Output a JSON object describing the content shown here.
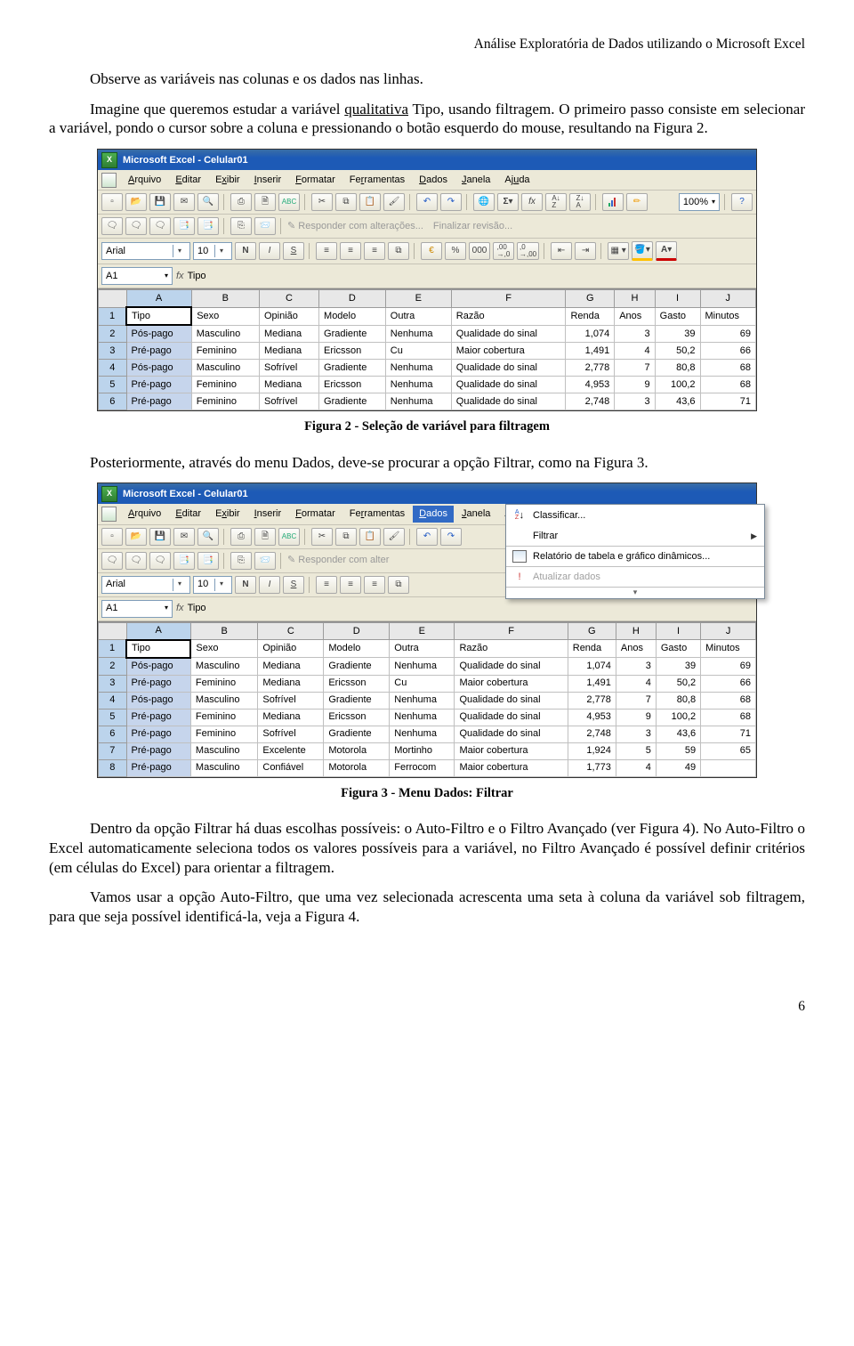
{
  "header": "Análise Exploratória de Dados utilizando o Microsoft Excel",
  "para1_a": "Observe as variáveis nas colunas e os dados nas linhas.",
  "para2_a": "Imagine que queremos estudar a variável ",
  "para2_b": "qualitativa",
  "para2_c": " Tipo, usando filtragem. O primeiro passo consiste em selecionar a variável, pondo o cursor sobre a coluna e pressionando o botão esquerdo do mouse, resultando na Figura 2.",
  "caption1": "Figura 2 - Seleção de variável para filtragem",
  "para3": "Posteriormente, através do menu Dados, deve-se procurar a opção Filtrar, como na Figura 3.",
  "caption2": "Figura 3 - Menu Dados: Filtrar",
  "para4": "Dentro da opção Filtrar há duas escolhas possíveis: o Auto-Filtro e o Filtro Avançado (ver Figura 4). No Auto-Filtro o Excel automaticamente seleciona todos os valores possíveis para a variável, no Filtro Avançado é possível definir critérios (em células do Excel) para orientar a filtragem.",
  "para5": "Vamos usar a opção Auto-Filtro, que uma vez selecionada acrescenta uma seta à coluna da variável sob filtragem, para que seja possível identificá-la, veja a Figura 4.",
  "page": "6",
  "excel": {
    "title": "Microsoft Excel - Celular01",
    "menus": {
      "arquivo": "Arquivo",
      "editar": "Editar",
      "exibir": "Exibir",
      "inserir": "Inserir",
      "formatar": "Formatar",
      "ferramentas": "Ferramentas",
      "dados": "Dados",
      "janela": "Janela",
      "ajuda": "Ajuda"
    },
    "toolbar": {
      "responder": "Responder com alterações...",
      "finalizar": "Finalizar revisão..."
    },
    "font": "Arial",
    "fontsize": "10",
    "zoom": "100%",
    "namebox": "A1",
    "fx": "Tipo",
    "cols": [
      "A",
      "B",
      "C",
      "D",
      "E",
      "F",
      "G",
      "H",
      "I",
      "J"
    ],
    "head": [
      "Tipo",
      "Sexo",
      "Opinião",
      "Modelo",
      "Outra",
      "Razão",
      "Renda",
      "Anos",
      "Gasto",
      "Minutos"
    ],
    "rows1": [
      [
        "Pós-pago",
        "Masculino",
        "Mediana",
        "Gradiente",
        "Nenhuma",
        "Qualidade do sinal",
        "1,074",
        "3",
        "39",
        "69"
      ],
      [
        "Pré-pago",
        "Feminino",
        "Mediana",
        "Ericsson",
        "Cu",
        "Maior cobertura",
        "1,491",
        "4",
        "50,2",
        "66"
      ],
      [
        "Pós-pago",
        "Masculino",
        "Sofrível",
        "Gradiente",
        "Nenhuma",
        "Qualidade do sinal",
        "2,778",
        "7",
        "80,8",
        "68"
      ],
      [
        "Pré-pago",
        "Feminino",
        "Mediana",
        "Ericsson",
        "Nenhuma",
        "Qualidade do sinal",
        "4,953",
        "9",
        "100,2",
        "68"
      ],
      [
        "Pré-pago",
        "Feminino",
        "Sofrível",
        "Gradiente",
        "Nenhuma",
        "Qualidade do sinal",
        "2,748",
        "3",
        "43,6",
        "71"
      ]
    ],
    "rows2": [
      [
        "Pós-pago",
        "Masculino",
        "Mediana",
        "Gradiente",
        "Nenhuma",
        "Qualidade do sinal",
        "1,074",
        "3",
        "39",
        "69"
      ],
      [
        "Pré-pago",
        "Feminino",
        "Mediana",
        "Ericsson",
        "Cu",
        "Maior cobertura",
        "1,491",
        "4",
        "50,2",
        "66"
      ],
      [
        "Pós-pago",
        "Masculino",
        "Sofrível",
        "Gradiente",
        "Nenhuma",
        "Qualidade do sinal",
        "2,778",
        "7",
        "80,8",
        "68"
      ],
      [
        "Pré-pago",
        "Feminino",
        "Mediana",
        "Ericsson",
        "Nenhuma",
        "Qualidade do sinal",
        "4,953",
        "9",
        "100,2",
        "68"
      ],
      [
        "Pré-pago",
        "Feminino",
        "Sofrível",
        "Gradiente",
        "Nenhuma",
        "Qualidade do sinal",
        "2,748",
        "3",
        "43,6",
        "71"
      ],
      [
        "Pré-pago",
        "Masculino",
        "Excelente",
        "Motorola",
        "Mortinho",
        "Maior cobertura",
        "1,924",
        "5",
        "59",
        "65"
      ],
      [
        "Pré-pago",
        "Masculino",
        "Confiável",
        "Motorola",
        "Ferrocom",
        "Maior cobertura",
        "1,773",
        "4",
        "49",
        ""
      ]
    ],
    "dadosmenu": {
      "classificar": "Classificar...",
      "filtrar": "Filtrar",
      "relatorio": "Relatório de tabela e gráfico dinâmicos...",
      "atualizar": "Atualizar dados"
    }
  }
}
